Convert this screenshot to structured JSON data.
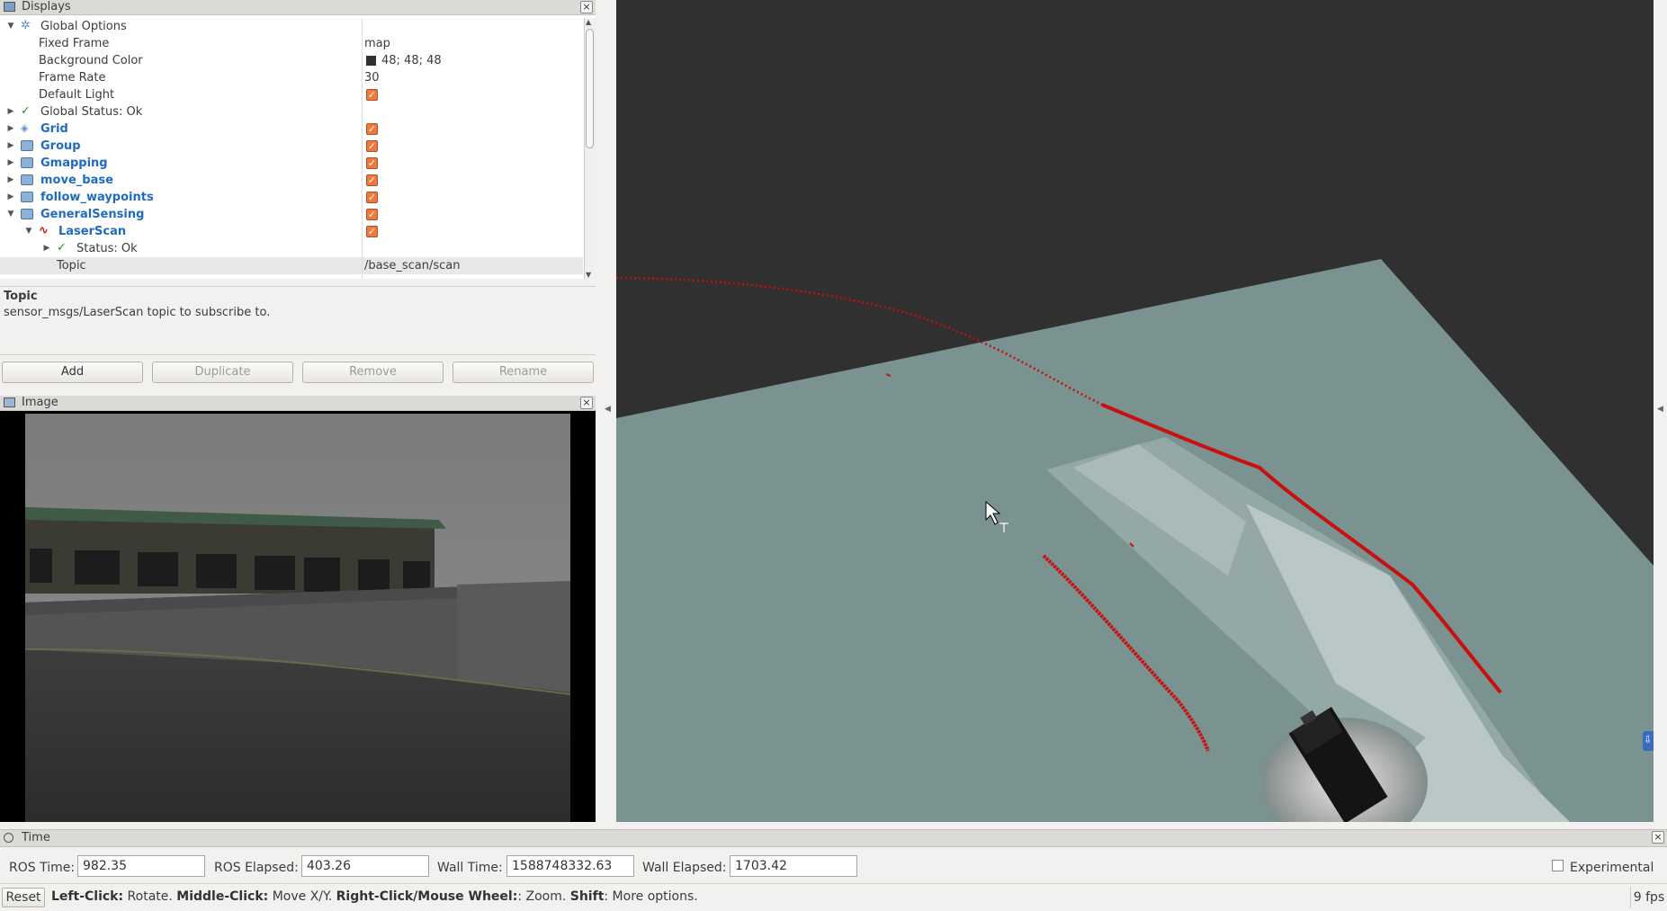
{
  "displays_panel": {
    "title": "Displays",
    "rows": [
      {
        "label": "Global Options",
        "value": ""
      },
      {
        "label": "Fixed Frame",
        "value": "map"
      },
      {
        "label": "Background Color",
        "value": "48; 48; 48"
      },
      {
        "label": "Frame Rate",
        "value": "30"
      },
      {
        "label": "Default Light",
        "value": ""
      },
      {
        "label": "Global Status: Ok",
        "value": ""
      },
      {
        "label": "Grid",
        "value": ""
      },
      {
        "label": "Group",
        "value": ""
      },
      {
        "label": "Gmapping",
        "value": ""
      },
      {
        "label": "move_base",
        "value": ""
      },
      {
        "label": "follow_waypoints",
        "value": ""
      },
      {
        "label": "GeneralSensing",
        "value": ""
      },
      {
        "label": "LaserScan",
        "value": ""
      },
      {
        "label": "Status: Ok",
        "value": ""
      },
      {
        "label": "Topic",
        "value": "/base_scan/scan"
      }
    ],
    "background_color_swatch": "#303030",
    "checkbox_color": "#ee7a3f",
    "link_color": "#1f6bbf"
  },
  "description": {
    "heading": "Topic",
    "text": "sensor_msgs/LaserScan topic to subscribe to."
  },
  "buttons": {
    "add": "Add",
    "duplicate": "Duplicate",
    "remove": "Remove",
    "rename": "Rename"
  },
  "image_panel": {
    "title": "Image"
  },
  "view3d": {
    "background": "#303030",
    "grid_color": "#7a9290",
    "scan_color": "#d01010"
  },
  "time_panel": {
    "title": "Time",
    "ros_time_label": "ROS Time:",
    "ros_time": "982.35",
    "ros_elapsed_label": "ROS Elapsed:",
    "ros_elapsed": "403.26",
    "wall_time_label": "Wall Time:",
    "wall_time": "1588748332.63",
    "wall_elapsed_label": "Wall Elapsed:",
    "wall_elapsed": "1703.42",
    "experimental_label": "Experimental"
  },
  "status_bar": {
    "reset": "Reset",
    "hint_parts": [
      {
        "bold": "Left-Click:",
        "text": " Rotate. "
      },
      {
        "bold": "Middle-Click:",
        "text": " Move X/Y. "
      },
      {
        "bold": "Right-Click/Mouse Wheel:",
        "text": ": Zoom. "
      },
      {
        "bold": "Shift",
        "text": ": More options."
      }
    ],
    "fps": "9 fps"
  }
}
